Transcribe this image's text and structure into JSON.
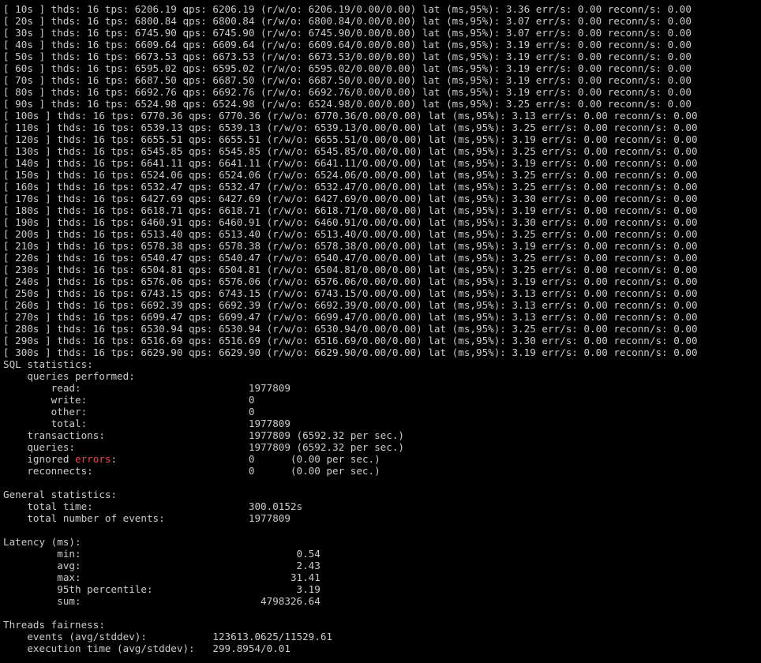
{
  "colors": {
    "background": "#000000",
    "foreground": "#cccccc",
    "error_word": "#e74856"
  },
  "lines": [
    "[ 10s ] thds: 16 tps: 6206.19 qps: 6206.19 (r/w/o: 6206.19/0.00/0.00) lat (ms,95%): 3.36 err/s: 0.00 reconn/s: 0.00",
    "[ 20s ] thds: 16 tps: 6800.84 qps: 6800.84 (r/w/o: 6800.84/0.00/0.00) lat (ms,95%): 3.07 err/s: 0.00 reconn/s: 0.00",
    "[ 30s ] thds: 16 tps: 6745.90 qps: 6745.90 (r/w/o: 6745.90/0.00/0.00) lat (ms,95%): 3.07 err/s: 0.00 reconn/s: 0.00",
    "[ 40s ] thds: 16 tps: 6609.64 qps: 6609.64 (r/w/o: 6609.64/0.00/0.00) lat (ms,95%): 3.19 err/s: 0.00 reconn/s: 0.00",
    "[ 50s ] thds: 16 tps: 6673.53 qps: 6673.53 (r/w/o: 6673.53/0.00/0.00) lat (ms,95%): 3.19 err/s: 0.00 reconn/s: 0.00",
    "[ 60s ] thds: 16 tps: 6595.02 qps: 6595.02 (r/w/o: 6595.02/0.00/0.00) lat (ms,95%): 3.19 err/s: 0.00 reconn/s: 0.00",
    "[ 70s ] thds: 16 tps: 6687.50 qps: 6687.50 (r/w/o: 6687.50/0.00/0.00) lat (ms,95%): 3.19 err/s: 0.00 reconn/s: 0.00",
    "[ 80s ] thds: 16 tps: 6692.76 qps: 6692.76 (r/w/o: 6692.76/0.00/0.00) lat (ms,95%): 3.19 err/s: 0.00 reconn/s: 0.00",
    "[ 90s ] thds: 16 tps: 6524.98 qps: 6524.98 (r/w/o: 6524.98/0.00/0.00) lat (ms,95%): 3.25 err/s: 0.00 reconn/s: 0.00",
    "[ 100s ] thds: 16 tps: 6770.36 qps: 6770.36 (r/w/o: 6770.36/0.00/0.00) lat (ms,95%): 3.13 err/s: 0.00 reconn/s: 0.00",
    "[ 110s ] thds: 16 tps: 6539.13 qps: 6539.13 (r/w/o: 6539.13/0.00/0.00) lat (ms,95%): 3.25 err/s: 0.00 reconn/s: 0.00",
    "[ 120s ] thds: 16 tps: 6655.51 qps: 6655.51 (r/w/o: 6655.51/0.00/0.00) lat (ms,95%): 3.19 err/s: 0.00 reconn/s: 0.00",
    "[ 130s ] thds: 16 tps: 6545.85 qps: 6545.85 (r/w/o: 6545.85/0.00/0.00) lat (ms,95%): 3.25 err/s: 0.00 reconn/s: 0.00",
    "[ 140s ] thds: 16 tps: 6641.11 qps: 6641.11 (r/w/o: 6641.11/0.00/0.00) lat (ms,95%): 3.19 err/s: 0.00 reconn/s: 0.00",
    "[ 150s ] thds: 16 tps: 6524.06 qps: 6524.06 (r/w/o: 6524.06/0.00/0.00) lat (ms,95%): 3.25 err/s: 0.00 reconn/s: 0.00",
    "[ 160s ] thds: 16 tps: 6532.47 qps: 6532.47 (r/w/o: 6532.47/0.00/0.00) lat (ms,95%): 3.25 err/s: 0.00 reconn/s: 0.00",
    "[ 170s ] thds: 16 tps: 6427.69 qps: 6427.69 (r/w/o: 6427.69/0.00/0.00) lat (ms,95%): 3.30 err/s: 0.00 reconn/s: 0.00",
    "[ 180s ] thds: 16 tps: 6618.71 qps: 6618.71 (r/w/o: 6618.71/0.00/0.00) lat (ms,95%): 3.19 err/s: 0.00 reconn/s: 0.00",
    "[ 190s ] thds: 16 tps: 6460.91 qps: 6460.91 (r/w/o: 6460.91/0.00/0.00) lat (ms,95%): 3.30 err/s: 0.00 reconn/s: 0.00",
    "[ 200s ] thds: 16 tps: 6513.40 qps: 6513.40 (r/w/o: 6513.40/0.00/0.00) lat (ms,95%): 3.25 err/s: 0.00 reconn/s: 0.00",
    "[ 210s ] thds: 16 tps: 6578.38 qps: 6578.38 (r/w/o: 6578.38/0.00/0.00) lat (ms,95%): 3.19 err/s: 0.00 reconn/s: 0.00",
    "[ 220s ] thds: 16 tps: 6540.47 qps: 6540.47 (r/w/o: 6540.47/0.00/0.00) lat (ms,95%): 3.25 err/s: 0.00 reconn/s: 0.00",
    "[ 230s ] thds: 16 tps: 6504.81 qps: 6504.81 (r/w/o: 6504.81/0.00/0.00) lat (ms,95%): 3.25 err/s: 0.00 reconn/s: 0.00",
    "[ 240s ] thds: 16 tps: 6576.06 qps: 6576.06 (r/w/o: 6576.06/0.00/0.00) lat (ms,95%): 3.19 err/s: 0.00 reconn/s: 0.00",
    "[ 250s ] thds: 16 tps: 6743.15 qps: 6743.15 (r/w/o: 6743.15/0.00/0.00) lat (ms,95%): 3.13 err/s: 0.00 reconn/s: 0.00",
    "[ 260s ] thds: 16 tps: 6692.39 qps: 6692.39 (r/w/o: 6692.39/0.00/0.00) lat (ms,95%): 3.13 err/s: 0.00 reconn/s: 0.00",
    "[ 270s ] thds: 16 tps: 6699.47 qps: 6699.47 (r/w/o: 6699.47/0.00/0.00) lat (ms,95%): 3.13 err/s: 0.00 reconn/s: 0.00",
    "[ 280s ] thds: 16 tps: 6530.94 qps: 6530.94 (r/w/o: 6530.94/0.00/0.00) lat (ms,95%): 3.25 err/s: 0.00 reconn/s: 0.00",
    "[ 290s ] thds: 16 tps: 6516.69 qps: 6516.69 (r/w/o: 6516.69/0.00/0.00) lat (ms,95%): 3.30 err/s: 0.00 reconn/s: 0.00",
    "[ 300s ] thds: 16 tps: 6629.90 qps: 6629.90 (r/w/o: 6629.90/0.00/0.00) lat (ms,95%): 3.19 err/s: 0.00 reconn/s: 0.00",
    "SQL statistics:",
    "    queries performed:",
    "        read:                            1977809",
    "        write:                           0",
    "        other:                           0",
    "        total:                           1977809",
    "    transactions:                        1977809 (6592.32 per sec.)",
    "    queries:                             1977809 (6592.32 per sec.)",
    "    ignored errors:                      0      (0.00 per sec.)",
    "    reconnects:                          0      (0.00 per sec.)",
    "",
    "General statistics:",
    "    total time:                          300.0152s",
    "    total number of events:              1977809",
    "",
    "Latency (ms):",
    "         min:                                    0.54",
    "         avg:                                    2.43",
    "         max:                                   31.41",
    "         95th percentile:                        3.19",
    "         sum:                              4798326.64",
    "",
    "Threads fairness:",
    "    events (avg/stddev):           123613.0625/11529.61",
    "    execution time (avg/stddev):   299.8954/0.01"
  ],
  "highlight": {
    "line_index": 38,
    "prefix": "    ignored ",
    "word": "errors",
    "suffix": ":                      0      (0.00 per sec.)"
  }
}
